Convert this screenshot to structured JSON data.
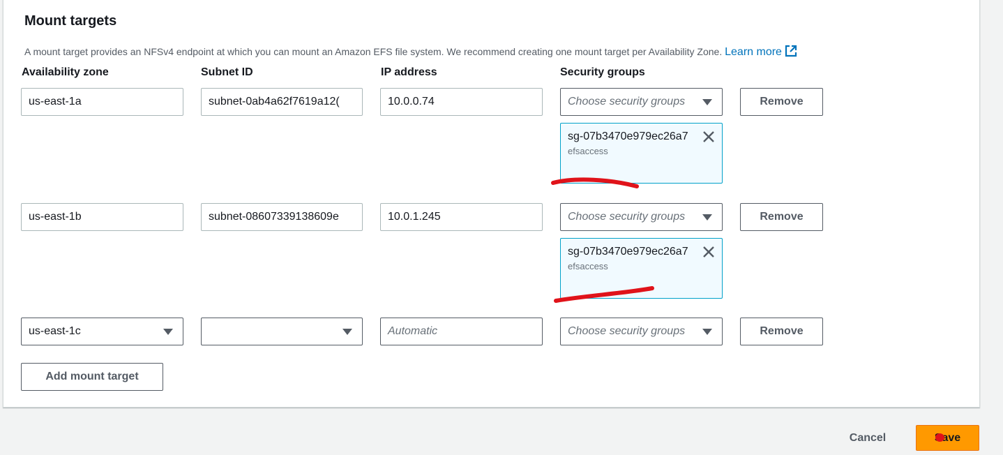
{
  "section": {
    "title": "Mount targets",
    "description": "A mount target provides an NFSv4 endpoint at which you can mount an Amazon EFS file system. We recommend creating one mount target per Availability Zone.",
    "learn_more": "Learn more"
  },
  "columns": {
    "az": "Availability zone",
    "subnet": "Subnet ID",
    "ip": "IP address",
    "sg": "Security groups"
  },
  "rows": [
    {
      "az": "us-east-1a",
      "subnet": "subnet-0ab4a62f7619a12(",
      "ip": "10.0.0.74",
      "sg_placeholder": "Choose security groups",
      "token_id": "sg-07b3470e979ec26a7",
      "token_name": "efsaccess",
      "remove": "Remove"
    },
    {
      "az": "us-east-1b",
      "subnet": "subnet-08607339138609e",
      "ip": "10.0.1.245",
      "sg_placeholder": "Choose security groups",
      "token_id": "sg-07b3470e979ec26a7",
      "token_name": "efsaccess",
      "remove": "Remove"
    },
    {
      "az": "us-east-1c",
      "subnet": "",
      "ip_placeholder": "Automatic",
      "sg_placeholder": "Choose security groups",
      "remove": "Remove"
    }
  ],
  "add_mount_target": "Add mount target",
  "footer": {
    "cancel": "Cancel",
    "save": "Save"
  },
  "colors": {
    "primary": "#ff9900",
    "link": "#0073bb",
    "token_border": "#00a1c9",
    "annotation": "#e0131a"
  }
}
